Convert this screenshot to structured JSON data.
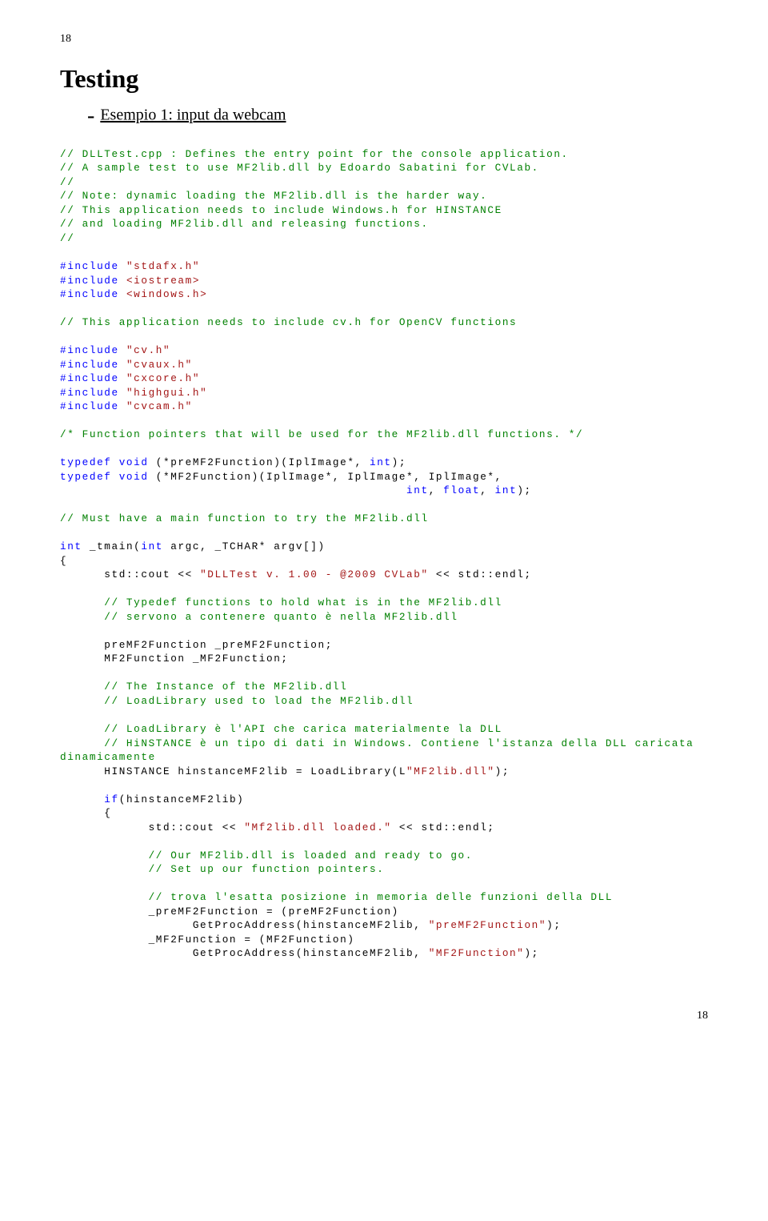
{
  "page_number_top": "18",
  "title": "Testing",
  "subtitle": "Esempio 1: input da webcam",
  "code": {
    "c01": "// DLLTest.cpp : Defines the entry point for the console application.",
    "c02": "// A sample test to use MF2lib.dll by Edoardo Sabatini for CVLab.",
    "c03": "//",
    "c04": "// Note: dynamic loading the MF2lib.dll is the harder way.",
    "c05": "// This application needs to include Windows.h for HINSTANCE",
    "c06": "// and loading MF2lib.dll and releasing functions.",
    "c07": "//",
    "inc01a": "#include",
    "inc01b": "\"stdafx.h\"",
    "inc02a": "#include",
    "inc02b": "<iostream>",
    "inc03a": "#include",
    "inc03b": "<windows.h>",
    "c08": "// This application needs to include cv.h for OpenCV functions",
    "inc04a": "#include",
    "inc04b": "\"cv.h\"",
    "inc05a": "#include",
    "inc05b": "\"cvaux.h\"",
    "inc06a": "#include",
    "inc06b": "\"cxcore.h\"",
    "inc07a": "#include",
    "inc07b": "\"highgui.h\"",
    "inc08a": "#include",
    "inc08b": "\"cvcam.h\"",
    "c09": "/* Function pointers that will be used for the MF2lib.dll functions. */",
    "td01a": "typedef",
    "td01b": "void",
    "td01c": " (*preMF2Function)(IplImage*, ",
    "td01d": "int",
    "td01e": ");",
    "td02a": "typedef",
    "td02b": "void",
    "td02c": " (*MF2Function)(IplImage*, IplImage*, IplImage*,",
    "td02d": "int",
    "td02e": ", ",
    "td02f": "float",
    "td02g": ", ",
    "td02h": "int",
    "td02i": ");",
    "td02pad": "                                               ",
    "c10": "// Must have a main function to try the MF2lib.dll",
    "m01a": "int",
    "m01b": " _tmain(",
    "m01c": "int",
    "m01d": " argc, _TCHAR* argv[])",
    "m02": "{",
    "m03a": "      std::cout << ",
    "m03b": "\"DLLTest v. 1.00 - @2009 CVLab\"",
    "m03c": " << std::endl;",
    "c11": "      // Typedef functions to hold what is in the MF2lib.dll",
    "c12": "      // servono a contenere quanto è nella MF2lib.dll",
    "m04": "      preMF2Function _preMF2Function;",
    "m05": "      MF2Function _MF2Function;",
    "c13": "      // The Instance of the MF2lib.dll",
    "c14": "      // LoadLibrary used to load the MF2lib.dll",
    "c15": "      // LoadLibrary è l'API che carica materialmente la DLL",
    "c16": "      // HiNSTANCE è un tipo di dati in Windows. Contiene l'istanza della DLL caricata",
    "c16b": "dinamicamente",
    "m06a": "      HINSTANCE hinstanceMF2lib = LoadLibrary(L",
    "m06b": "\"MF2lib.dll\"",
    "m06c": ");",
    "m07a": "      ",
    "m07b": "if",
    "m07c": "(hinstanceMF2lib)",
    "m08": "      {",
    "m09a": "            std::cout << ",
    "m09b": "\"Mf2lib.dll loaded.\"",
    "m09c": " << std::endl;",
    "c17": "            // Our MF2lib.dll is loaded and ready to go.",
    "c18": "            // Set up our function pointers.",
    "c19": "            // trova l'esatta posizione in memoria delle funzioni della DLL",
    "m10": "            _preMF2Function = (preMF2Function)",
    "m11a": "                  GetProcAddress(hinstanceMF2lib, ",
    "m11b": "\"preMF2Function\"",
    "m11c": ");",
    "m12": "            _MF2Function = (MF2Function)",
    "m13a": "                  GetProcAddress(hinstanceMF2lib, ",
    "m13b": "\"MF2Function\"",
    "m13c": ");"
  },
  "page_number_bottom": "18"
}
